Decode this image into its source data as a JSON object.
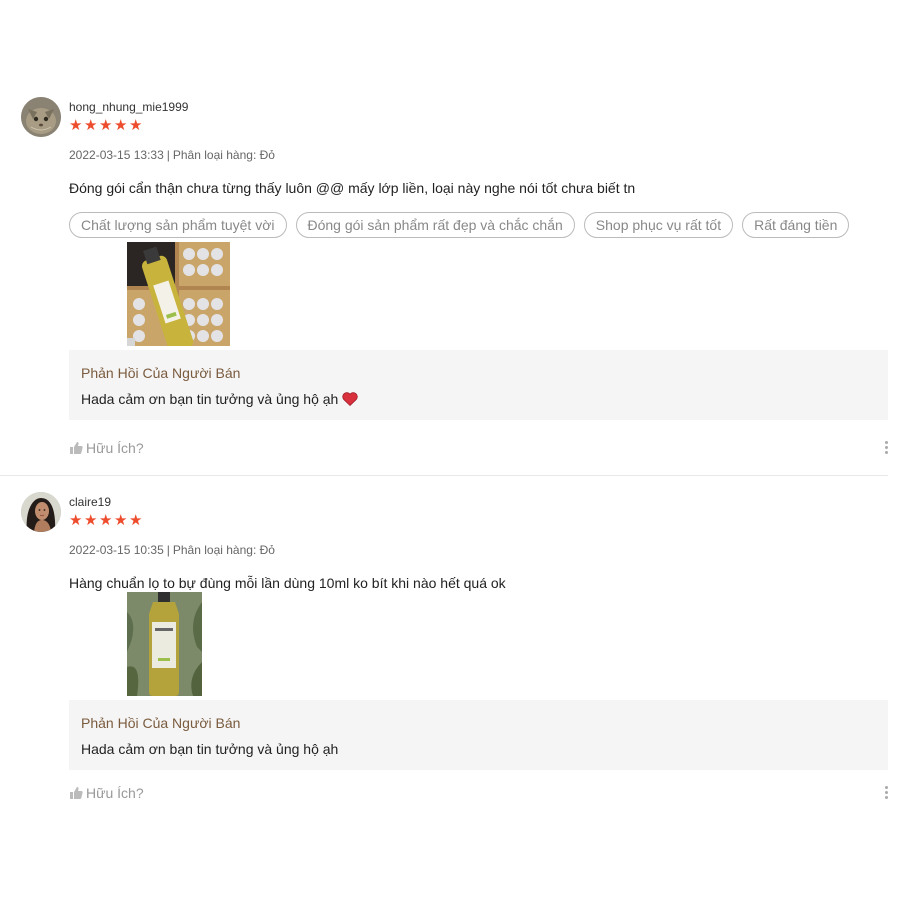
{
  "reviews": [
    {
      "username": "hong_nhung_mie1999",
      "rating": 5,
      "date": "2022-03-15 13:33",
      "separator": "|",
      "variation": "Phân loại hàng: Đỏ",
      "comment": "Đóng gói cẩn thận chưa từng thấy luôn @@ mấy lớp liền, loại này nghe nói tốt chưa biết tn",
      "tags": [
        "Chất lượng sản phẩm tuyệt vời",
        "Đóng gói sản phẩm rất đẹp và chắc chắn",
        "Shop phục vụ rất tốt",
        "Rất đáng tiền"
      ],
      "seller_reply": {
        "title": "Phản Hồi Của Người Bán",
        "text": "Hada cảm ơn bạn tin tưởng và ủng hộ ạh"
      },
      "helpful_label": "Hữu Ích?"
    },
    {
      "username": "claire19",
      "rating": 5,
      "date": "2022-03-15 10:35",
      "separator": "|",
      "variation": "Phân loại hàng: Đỏ",
      "comment": "Hàng chuẩn lọ to bự đùng mỗi lần dùng 10ml ko bít khi nào hết quá ok",
      "seller_reply": {
        "title": "Phản Hồi Của Người Bán",
        "text": "Hada cảm ơn bạn tin tưởng và ủng hộ ạh"
      },
      "helpful_label": "Hữu Ích?"
    }
  ],
  "colors": {
    "star": "#ee4d2d",
    "reply_title": "#7a5b3e",
    "reply_bg": "#f5f5f5"
  },
  "icons": {
    "star": "star-icon",
    "helpful": "thumbs-up-icon",
    "more": "more-vertical-icon",
    "heart": "heart-icon"
  }
}
